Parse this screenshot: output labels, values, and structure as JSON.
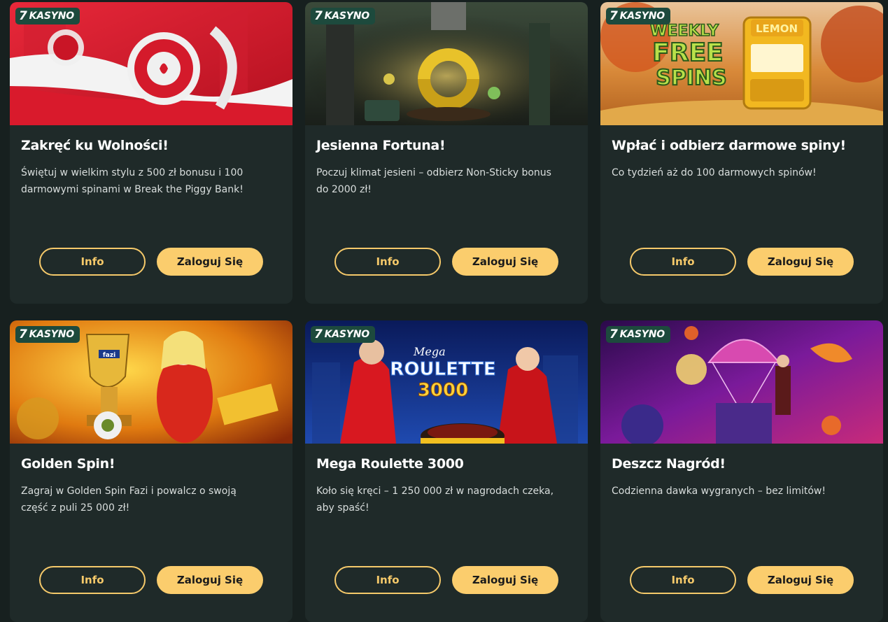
{
  "colors": {
    "page_bg": "#17201f",
    "card_bg": "#1f2a29",
    "badge_bg": "#1d4a3d",
    "accent": "#fbcd6d"
  },
  "cards": [
    {
      "badge_icon": "seven-logo-icon",
      "badge_icon_text": "7",
      "badge": "KASYNO",
      "title": "Zakręć ku Wolności!",
      "description": "Świętuj w wielkim stylu z 500 zł bonusu i 100 darmowymi spinami w Break the Piggy Bank!",
      "info_label": "Info",
      "login_label": "Zaloguj Się"
    },
    {
      "badge_icon": "seven-logo-icon",
      "badge_icon_text": "7",
      "badge": "KASYNO",
      "title": "Jesienna Fortuna!",
      "description": "Poczuj klimat jesieni – odbierz Non-Sticky bonus do 2000 zł!",
      "info_label": "Info",
      "login_label": "Zaloguj Się"
    },
    {
      "badge_icon": "seven-logo-icon",
      "badge_icon_text": "7",
      "badge": "KASYNO",
      "title": "Wpłać i odbierz darmowe spiny!",
      "description": "Co tydzień aż do 100 darmowych spinów!",
      "banner_text_1": "WEEKLY",
      "banner_text_2": "FREE",
      "banner_text_3": "SPINS",
      "banner_text_4": "LEMON",
      "info_label": "Info",
      "login_label": "Zaloguj Się"
    },
    {
      "badge_icon": "seven-logo-icon",
      "badge_icon_text": "7",
      "badge": "KASYNO",
      "title": "Golden Spin!",
      "description": "Zagraj w Golden Spin Fazi i powalcz o swoją część z puli 25 000 zł!",
      "banner_text_1": "fazi",
      "info_label": "Info",
      "login_label": "Zaloguj Się"
    },
    {
      "badge_icon": "seven-logo-icon",
      "badge_icon_text": "7",
      "badge": "KASYNO",
      "title": "Mega Roulette 3000",
      "description": "Koło się kręci – 1 250 000 zł w nagrodach czeka, aby spaść!",
      "banner_text_1": "Mega",
      "banner_text_2": "ROULETTE",
      "banner_text_3": "3000",
      "info_label": "Info",
      "login_label": "Zaloguj Się"
    },
    {
      "badge_icon": "seven-logo-icon",
      "badge_icon_text": "7",
      "badge": "KASYNO",
      "title": "Deszcz Nagród!",
      "description": "Codzienna dawka wygranych – bez limitów!",
      "info_label": "Info",
      "login_label": "Zaloguj Się"
    }
  ]
}
